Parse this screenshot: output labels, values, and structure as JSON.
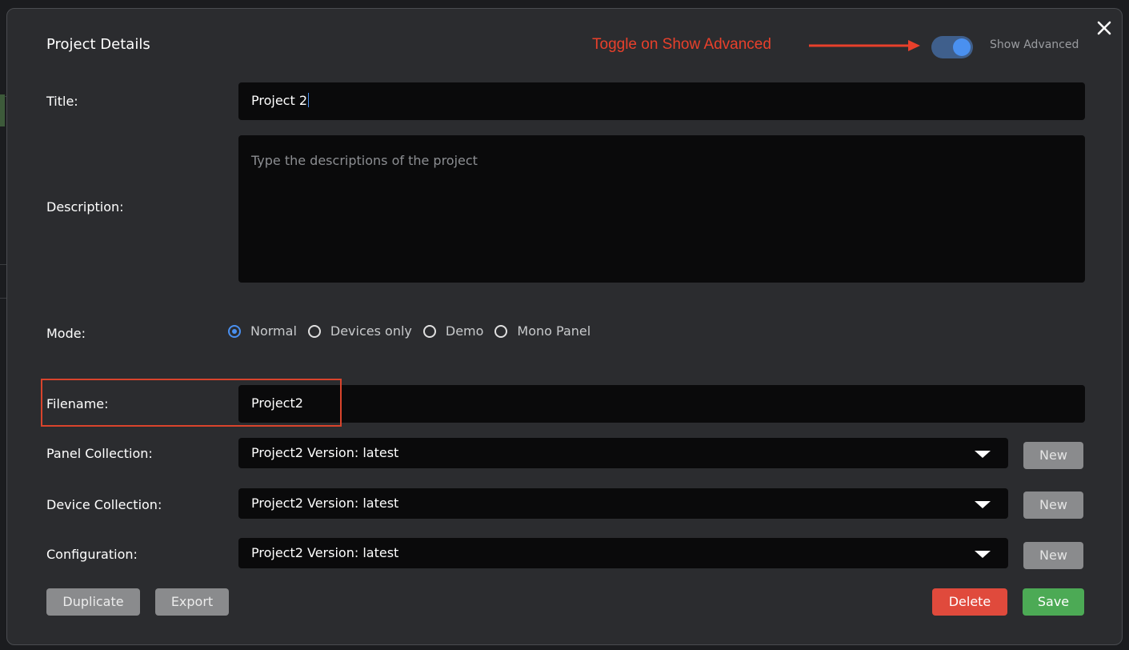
{
  "dialog": {
    "title": "Project Details",
    "annotation": "Toggle on Show Advanced",
    "show_advanced_label": "Show Advanced",
    "show_advanced_on": true
  },
  "form": {
    "title_label": "Title:",
    "title_value": "Project 2",
    "description_label": "Description:",
    "description_placeholder": "Type the descriptions of the project",
    "mode_label": "Mode:",
    "modes": [
      {
        "label": "Normal",
        "checked": true
      },
      {
        "label": "Devices only",
        "checked": false
      },
      {
        "label": "Demo",
        "checked": false
      },
      {
        "label": "Mono Panel",
        "checked": false
      }
    ],
    "filename_label": "Filename:",
    "filename_value": "Project2",
    "panel_collection_label": "Panel Collection:",
    "panel_collection_value": "Project2 Version: latest",
    "device_collection_label": "Device Collection:",
    "device_collection_value": "Project2 Version: latest",
    "configuration_label": "Configuration:",
    "configuration_value": "Project2 Version: latest",
    "new_label": "New"
  },
  "actions": {
    "duplicate": "Duplicate",
    "export": "Export",
    "delete": "Delete",
    "save": "Save"
  },
  "colors": {
    "accent": "#4a90f0",
    "annotation": "#e8402b",
    "delete": "#e04a3c",
    "save": "#4caa55",
    "background": "#2b2c2f"
  }
}
